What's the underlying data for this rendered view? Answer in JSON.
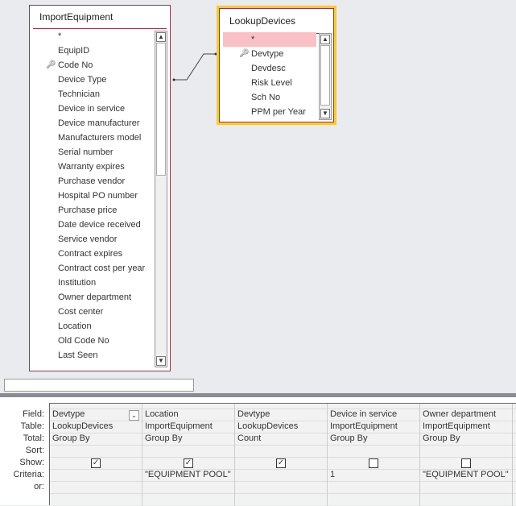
{
  "tables": {
    "import": {
      "title": "ImportEquipment",
      "fields": [
        "*",
        "EquipID",
        "Code No",
        "Device Type",
        "Technician",
        "Device in service",
        "Device manufacturer",
        "Manufacturers model",
        "Serial number",
        "Warranty expires",
        "Purchase vendor",
        "Hospital PO number",
        "Purchase price",
        "Date device received",
        "Service vendor",
        "Contract expires",
        "Contract cost per year",
        "Institution",
        "Owner department",
        "Cost center",
        "Location",
        "Old Code No",
        "Last Seen"
      ],
      "key_field": "Code No"
    },
    "lookup": {
      "title": "LookupDevices",
      "fields": [
        "*",
        "Devtype",
        "Devdesc",
        "Risk Level",
        "Sch No",
        "PPM per Year"
      ],
      "key_field": "Devtype"
    }
  },
  "grid": {
    "row_labels": [
      "Field:",
      "Table:",
      "Total:",
      "Sort:",
      "Show:",
      "Criteria:",
      "or:"
    ],
    "columns": [
      {
        "field": "Devtype",
        "table": "LookupDevices",
        "total": "Group By",
        "sort": "",
        "show": true,
        "criteria": "",
        "or": ""
      },
      {
        "field": "Location",
        "table": "ImportEquipment",
        "total": "Group By",
        "sort": "",
        "show": true,
        "criteria": "\"EQUIPMENT POOL\"",
        "or": ""
      },
      {
        "field": "Devtype",
        "table": "LookupDevices",
        "total": "Count",
        "sort": "",
        "show": true,
        "criteria": "",
        "or": ""
      },
      {
        "field": "Device in service",
        "table": "ImportEquipment",
        "total": "Group By",
        "sort": "",
        "show": false,
        "criteria": "1",
        "or": ""
      },
      {
        "field": "Owner department",
        "table": "ImportEquipment",
        "total": "Group By",
        "sort": "",
        "show": false,
        "criteria": "\"EQUIPMENT POOL\"",
        "or": ""
      }
    ]
  }
}
